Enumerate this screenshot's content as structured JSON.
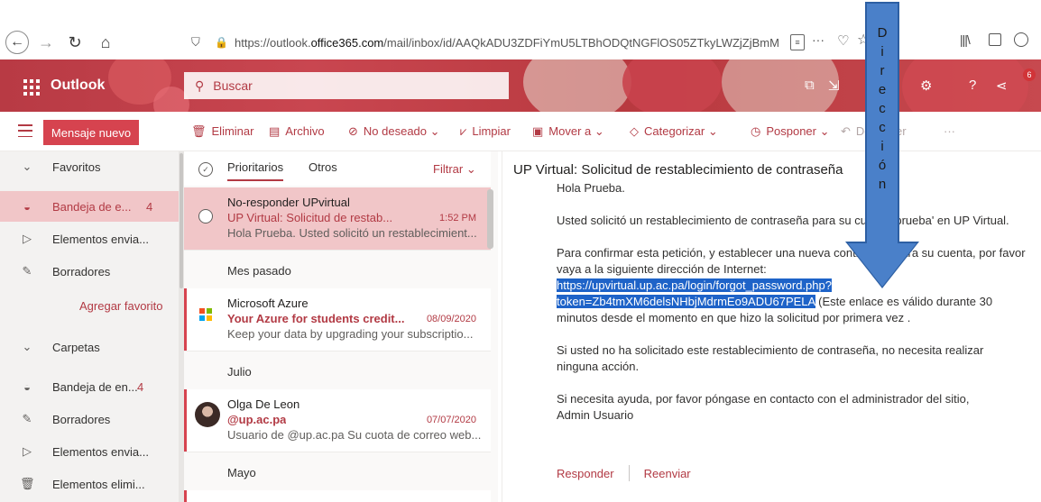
{
  "browser": {
    "url_prefix": "https://outlook.",
    "url_domain": "office365.com",
    "url_path": "/mail/inbox/id/AAQkADU3ZDFiYmU5LTBhODQtNGFlOS05ZTkyLWZjZjBmM"
  },
  "header": {
    "brand": "Outlook",
    "search_placeholder": "Buscar",
    "notification_count": "6"
  },
  "toolbar": {
    "new_message": "Mensaje nuevo",
    "delete": "Eliminar",
    "archive": "Archivo",
    "junk": "No deseado",
    "sweep": "Limpiar",
    "move_to": "Mover a",
    "categorize": "Categorizar",
    "snooze": "Posponer",
    "undo": "Deshacer"
  },
  "folders": {
    "favorites_header": "Favoritos",
    "items": [
      {
        "label": "Bandeja de e...",
        "count": "4"
      },
      {
        "label": "Elementos envia...",
        "count": ""
      },
      {
        "label": "Borradores",
        "count": ""
      }
    ],
    "add_favorite": "Agregar favorito",
    "folders_header": "Carpetas",
    "folder_items": [
      {
        "label": "Bandeja de en...",
        "count": "4"
      },
      {
        "label": "Borradores",
        "count": ""
      },
      {
        "label": "Elementos envia...",
        "count": ""
      },
      {
        "label": "Elementos elimi...",
        "count": ""
      }
    ]
  },
  "list": {
    "tab_focused": "Prioritarios",
    "tab_other": "Otros",
    "filter": "Filtrar",
    "groups": {
      "last_month": "Mes pasado",
      "july": "Julio",
      "may": "Mayo"
    },
    "messages": [
      {
        "from": "No-responder UPvirtual",
        "subject": "UP Virtual: Solicitud de restab...",
        "date": "1:52 PM",
        "preview": "Hola Prueba. Usted solicitó un restablecimient..."
      },
      {
        "from": "Microsoft Azure",
        "subject": "Your Azure for students credit...",
        "date": "08/09/2020",
        "preview": "Keep your data by upgrading your subscriptio..."
      },
      {
        "from": "Olga De Leon",
        "subject": "@up.ac.pa",
        "date": "07/07/2020",
        "preview": "Usuario de @up.ac.pa Su cuota de correo web..."
      }
    ]
  },
  "reading": {
    "subject": "UP Virtual: Solicitud de restablecimiento de contraseña",
    "greeting": "Hola Prueba.",
    "p1": "Usted solicitó un restablecimiento de contraseña para su cuenta 'prueba' en UP Virtual.",
    "p2_before": "Para confirmar esta petición, y establecer una nueva contraseña para su cuenta, por favor vaya a la siguiente dirección de Internet: ",
    "link": "https://upvirtual.up.ac.pa/login/forgot_password.php?token=Zb4tmXM6delsNHbjMdrmEo9ADU67PELA",
    "p2_after": " (Este enlace es válido durante 30 minutos desde el momento en que hizo la solicitud por primera vez .",
    "p3": "Si usted no ha solicitado este restablecimiento de contraseña, no necesita realizar ninguna acción.",
    "p4a": "Si necesita ayuda, por favor póngase en contacto con el administrador del sitio,",
    "p4b": "Admin Usuario",
    "reply": "Responder",
    "forward": "Reenviar"
  },
  "annotation": {
    "letters": [
      "D",
      "i",
      "r",
      "e",
      "c",
      "c",
      "i",
      "ó",
      "n"
    ]
  },
  "colors": {
    "accent": "#b23a44",
    "selection": "#f1c6c8",
    "arrow": "#4a80c9"
  }
}
